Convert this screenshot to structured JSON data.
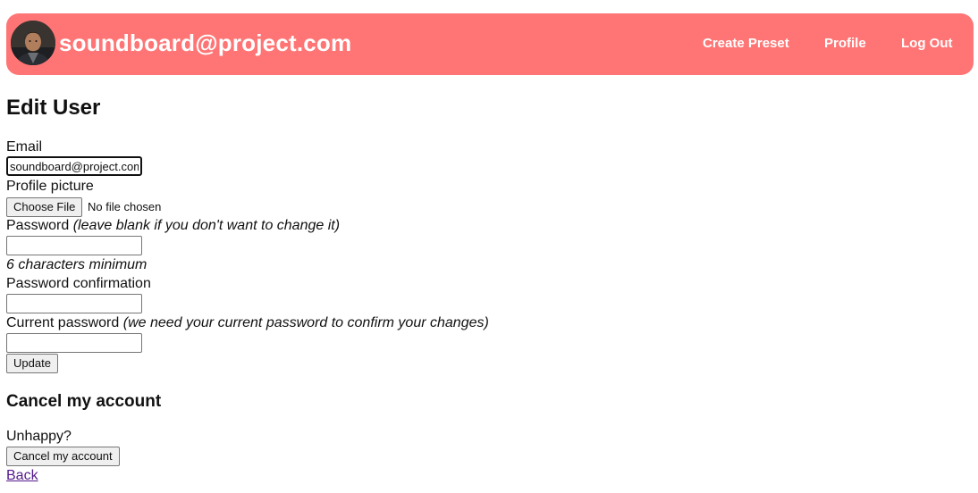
{
  "navbar": {
    "brand": "soundboard@project.com",
    "links": {
      "create_preset": "Create Preset",
      "profile": "Profile",
      "log_out": "Log Out"
    },
    "colors": {
      "background": "#ff7575",
      "text": "#ffffff"
    }
  },
  "page": {
    "title": "Edit User"
  },
  "form": {
    "email": {
      "label": "Email",
      "value": "soundboard@project.com"
    },
    "profile_picture": {
      "label": "Profile picture",
      "button": "Choose File",
      "status": "No file chosen"
    },
    "password": {
      "label": "Password",
      "note": "(leave blank if you don't want to change it)",
      "value": "",
      "hint": "6 characters minimum"
    },
    "password_confirmation": {
      "label": "Password confirmation",
      "value": ""
    },
    "current_password": {
      "label": "Current password",
      "note": "(we need your current password to confirm your changes)",
      "value": ""
    },
    "submit_label": "Update"
  },
  "cancel_section": {
    "title": "Cancel my account",
    "text": "Unhappy?",
    "button": "Cancel my account"
  },
  "back_link": "Back"
}
